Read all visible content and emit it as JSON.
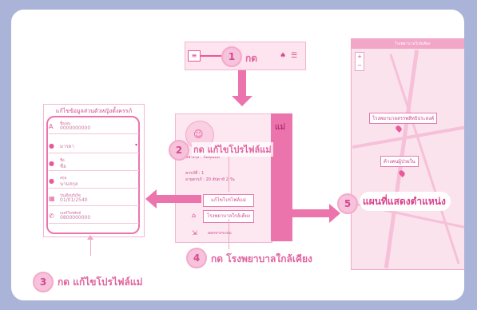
{
  "colors": {
    "accent": "#e96aa6",
    "border": "#a9b4d8",
    "arrow": "#ec74ad"
  },
  "steps": {
    "s1": {
      "num": "1",
      "label": "กด"
    },
    "s2": {
      "num": "2",
      "label": "กด แก้ไขโปรไฟล์แม่"
    },
    "s3": {
      "num": "3",
      "label": "กด แก้ไขโปรไฟล์แม่"
    },
    "s4": {
      "num": "4",
      "label": "กด โรงพยาบาลใกล้เคียง"
    },
    "s5": {
      "num": "5",
      "label": "แผนที่แสดงตำแหน่ง"
    }
  },
  "edit_profile": {
    "title": "แก้ไขข้อมูลส่วนตัวหญิงตั้งครรภ์",
    "fields": [
      {
        "icon": "user-icon",
        "label": "ชื่อเล่น",
        "value": "0000000000"
      },
      {
        "icon": "user-icon",
        "label": "",
        "value": "มารดา"
      },
      {
        "icon": "user-icon",
        "label": "ชื่อ",
        "value": "ชื่อ"
      },
      {
        "icon": "user-icon",
        "label": "สกุล",
        "value": "นามสกุล"
      },
      {
        "icon": "calendar-icon",
        "label": "วันเดือนปีเกิด",
        "value": "01/01/2540"
      },
      {
        "icon": "phone-icon",
        "label": "เบอร์โทรศัพท์",
        "value": "0800000000"
      }
    ]
  },
  "profile": {
    "name_line": "ชื่อ-สกุล : ชื่อคุณแม่",
    "pregnancy_line": "ครรภ์ที่ : 1",
    "age_line": "อายุครรภ์ : 20 สัปดาห์ 2 วัน",
    "edit_button": "แก้ไขโปรไฟล์แม่",
    "hospital_button": "โรงพยาบาลใกล้เคียง",
    "logout": "ออกจากระบบ",
    "side_text": "แม่"
  },
  "map": {
    "header": "โรงพยาบาลใกล้เคียง",
    "zoom_in": "+",
    "zoom_out": "−",
    "pins": [
      "โรงพยาบาลสรรพสิทธิประสงค์",
      "ค้างคนผู้ป่วยใน"
    ]
  }
}
